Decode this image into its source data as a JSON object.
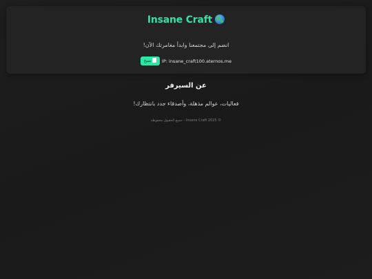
{
  "hero": {
    "title": "Insane Craft",
    "title_icon": "globe-icon",
    "subtitle": "انضم إلى مجتمعنا وابدأ مغامرتك الآن!",
    "copy_button_label": "نسخ",
    "ip_text": "IP: insane_craft100.aternos.me"
  },
  "about": {
    "title": "عن السيرفر",
    "text": "فعاليات، عوالم مذهلة، وأصدقاء جدد بانتظارك!"
  },
  "footer": {
    "text": "© Insane Craft 2025 - جميع الحقوق محفوظة"
  },
  "colors": {
    "accent": "#34e0a8",
    "button": "#2ee6a6",
    "background": "#1c1c1c",
    "card": "#232323"
  }
}
